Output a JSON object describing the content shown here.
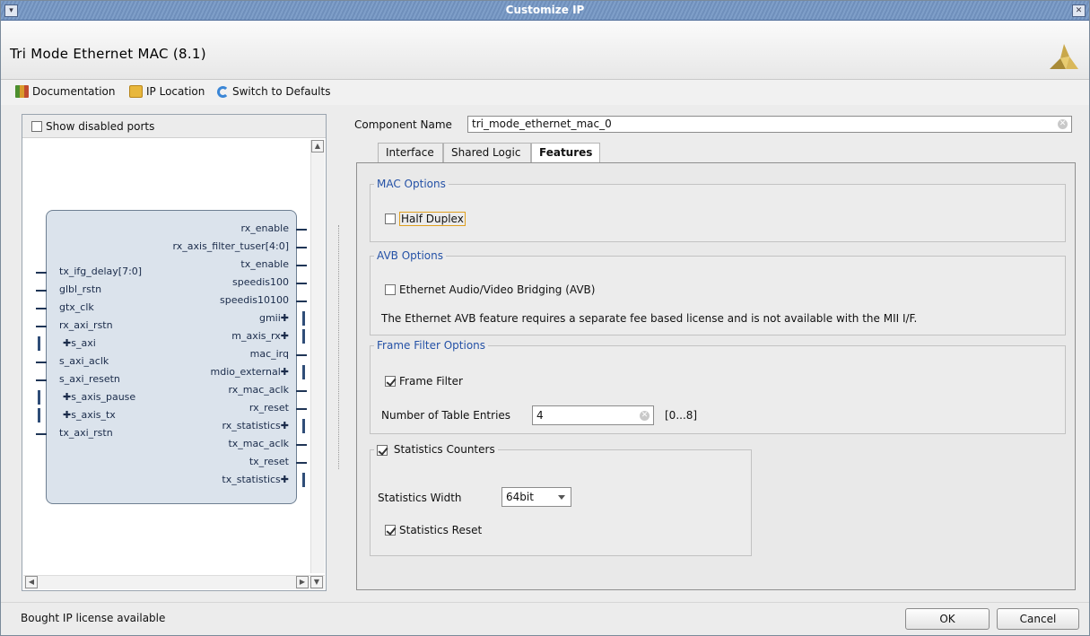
{
  "window": {
    "title": "Customize IP"
  },
  "header": {
    "ip_title": "Tri Mode Ethernet MAC (8.1)"
  },
  "docbar": {
    "documentation": "Documentation",
    "ip_location": "IP Location",
    "switch_defaults": "Switch to Defaults"
  },
  "left": {
    "show_disabled_label": "Show disabled ports",
    "show_disabled_checked": false,
    "ports_left": [
      "tx_ifg_delay[7:0]",
      "glbl_rstn",
      "gtx_clk",
      "rx_axi_rstn",
      "s_axi",
      "s_axi_aclk",
      "s_axi_resetn",
      "s_axis_pause",
      "s_axis_tx",
      "tx_axi_rstn"
    ],
    "ports_right": [
      "rx_enable",
      "rx_axis_filter_tuser[4:0]",
      "tx_enable",
      "speedis100",
      "speedis10100",
      "gmii",
      "m_axis_rx",
      "mac_irq",
      "mdio_external",
      "rx_mac_aclk",
      "rx_reset",
      "rx_statistics",
      "tx_mac_aclk",
      "tx_reset",
      "tx_statistics"
    ]
  },
  "component": {
    "label": "Component Name",
    "value": "tri_mode_ethernet_mac_0"
  },
  "tabs": [
    {
      "label": "Interface"
    },
    {
      "label": "Shared Logic"
    },
    {
      "label": "Features"
    }
  ],
  "mac_options": {
    "legend": "MAC Options",
    "half_duplex_label": "Half Duplex",
    "half_duplex_checked": false
  },
  "avb_options": {
    "legend": "AVB Options",
    "avb_label": "Ethernet Audio/Video Bridging (AVB)",
    "avb_checked": false,
    "note": "The Ethernet AVB feature requires a separate fee based license and is not available with the MII I/F."
  },
  "frame_filter": {
    "legend": "Frame Filter Options",
    "filter_label": "Frame Filter",
    "filter_checked": true,
    "entries_label": "Number of Table Entries",
    "entries_value": "4",
    "entries_range": "[0...8]"
  },
  "statistics": {
    "counters_label": "Statistics Counters",
    "counters_checked": true,
    "width_label": "Statistics Width",
    "width_value": "64bit",
    "reset_label": "Statistics Reset",
    "reset_checked": true
  },
  "footer": {
    "status": "Bought IP license available",
    "ok": "OK",
    "cancel": "Cancel"
  },
  "colors": {
    "title_bar": "#7f9fc9",
    "legend": "#2451a6",
    "block": "#dbe3ec"
  }
}
